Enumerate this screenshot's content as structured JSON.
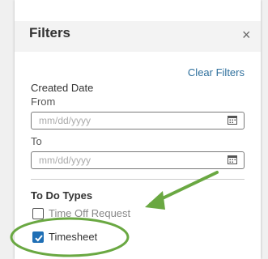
{
  "panel": {
    "title": "Filters",
    "close_icon": "close-icon",
    "clear_filters": "Clear Filters"
  },
  "created_date": {
    "label": "Created Date",
    "from_label": "From",
    "from_placeholder": "mm/dd/yyyy",
    "to_label": "To",
    "to_placeholder": "mm/dd/yyyy",
    "icon": "calendar-icon"
  },
  "todo_types": {
    "label": "To Do Types",
    "options": [
      {
        "label": "Time Off Request",
        "checked": false
      },
      {
        "label": "Timesheet",
        "checked": true
      }
    ]
  },
  "annotations": {
    "arrow_color": "#6aa842",
    "ellipse_color": "#6aa842"
  },
  "colors": {
    "link": "#2e6f9c",
    "checkbox_checked": "#1f6fb5"
  }
}
